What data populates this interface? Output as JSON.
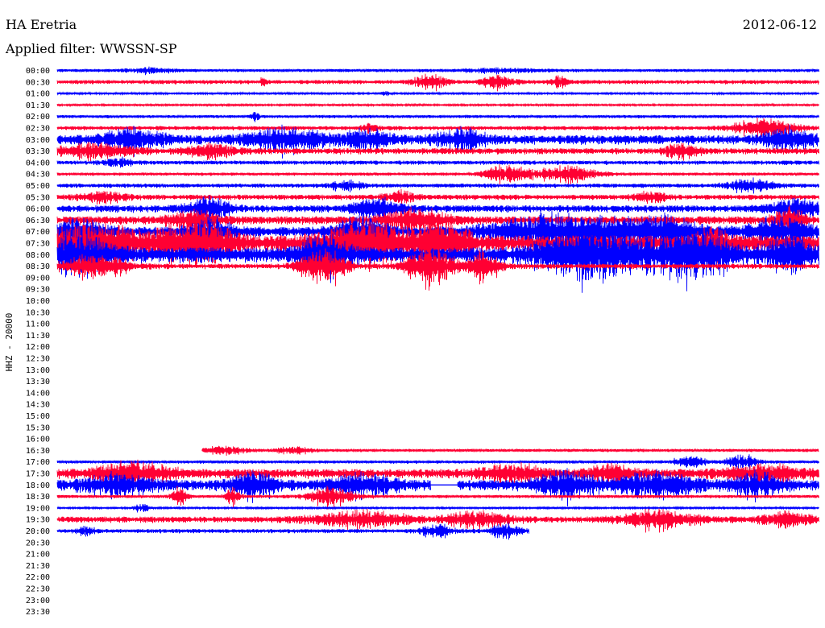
{
  "header": {
    "station": "HA Eretria",
    "date": "2012-06-12",
    "filter": "Applied filter: WWSSN-SP"
  },
  "chart_data": {
    "type": "line",
    "title": "HA Eretria",
    "channel_label": "HHZ - 20000",
    "row_labels": [
      "00:00",
      "00:30",
      "01:00",
      "01:30",
      "02:00",
      "02:30",
      "03:00",
      "03:30",
      "04:00",
      "04:30",
      "05:00",
      "05:30",
      "06:00",
      "06:30",
      "07:00",
      "07:30",
      "08:00",
      "08:30",
      "09:00",
      "09:30",
      "10:00",
      "10:30",
      "11:00",
      "11:30",
      "12:00",
      "12:30",
      "13:00",
      "13:30",
      "14:00",
      "14:30",
      "15:00",
      "15:30",
      "16:00",
      "16:30",
      "17:00",
      "17:30",
      "18:00",
      "18:30",
      "19:00",
      "19:30",
      "20:00",
      "20:30",
      "21:00",
      "21:30",
      "22:00",
      "22:30",
      "23:00",
      "23:30"
    ],
    "colors": {
      "even": "#0000ff",
      "odd": "#ff0033"
    },
    "traces": [
      {
        "row": 0,
        "start": 0,
        "end": 1,
        "level": 0.3,
        "bursts": [
          [
            0.12,
            0.03,
            0.4
          ],
          [
            0.58,
            0.05,
            0.3
          ]
        ]
      },
      {
        "row": 1,
        "start": 0,
        "end": 1,
        "level": 0.4,
        "bursts": [
          [
            0.49,
            0.02,
            1.4
          ],
          [
            0.58,
            0.02,
            1.2
          ],
          [
            0.66,
            0.01,
            1.0
          ],
          [
            0.27,
            0.005,
            0.7
          ]
        ]
      },
      {
        "row": 2,
        "start": 0,
        "end": 1,
        "level": 0.2,
        "bursts": [
          [
            0.43,
            0.005,
            0.6
          ]
        ]
      },
      {
        "row": 3,
        "start": 0,
        "end": 1,
        "level": 0.2,
        "bursts": []
      },
      {
        "row": 4,
        "start": 0,
        "end": 1,
        "level": 0.3,
        "bursts": [
          [
            0.26,
            0.005,
            0.8
          ]
        ]
      },
      {
        "row": 5,
        "start": 0,
        "end": 1,
        "level": 0.4,
        "bursts": [
          [
            0.93,
            0.04,
            1.6
          ],
          [
            0.41,
            0.01,
            0.7
          ]
        ]
      },
      {
        "row": 6,
        "start": 0,
        "end": 1,
        "level": 0.9,
        "bursts": [
          [
            0.1,
            0.04,
            1.6
          ],
          [
            0.3,
            0.05,
            1.8
          ],
          [
            0.41,
            0.03,
            1.5
          ],
          [
            0.53,
            0.03,
            1.7
          ],
          [
            0.96,
            0.03,
            1.6
          ]
        ]
      },
      {
        "row": 7,
        "start": 0,
        "end": 1,
        "level": 0.6,
        "bursts": [
          [
            0.05,
            0.05,
            1.2
          ],
          [
            0.2,
            0.03,
            1.1
          ],
          [
            0.82,
            0.02,
            1.2
          ]
        ]
      },
      {
        "row": 8,
        "start": 0,
        "end": 1,
        "level": 0.4,
        "bursts": [
          [
            0.08,
            0.02,
            0.7
          ]
        ]
      },
      {
        "row": 9,
        "start": 0,
        "end": 1,
        "level": 0.3,
        "bursts": [
          [
            0.59,
            0.03,
            1.5
          ],
          [
            0.67,
            0.04,
            1.3
          ]
        ]
      },
      {
        "row": 10,
        "start": 0,
        "end": 1,
        "level": 0.4,
        "bursts": [
          [
            0.38,
            0.02,
            0.8
          ],
          [
            0.91,
            0.03,
            1.0
          ]
        ]
      },
      {
        "row": 11,
        "start": 0,
        "end": 1,
        "level": 0.5,
        "bursts": [
          [
            0.06,
            0.03,
            0.9
          ],
          [
            0.45,
            0.02,
            1.0
          ],
          [
            0.78,
            0.02,
            1.0
          ]
        ]
      },
      {
        "row": 12,
        "start": 0,
        "end": 1,
        "level": 0.7,
        "bursts": [
          [
            0.2,
            0.03,
            1.6
          ],
          [
            0.42,
            0.03,
            1.7
          ],
          [
            0.97,
            0.03,
            1.7
          ]
        ]
      },
      {
        "row": 13,
        "start": 0,
        "end": 1,
        "level": 0.8,
        "bursts": [
          [
            0.18,
            0.03,
            1.5
          ],
          [
            0.47,
            0.04,
            1.7
          ],
          [
            0.96,
            0.02,
            2.0
          ]
        ]
      },
      {
        "row": 14,
        "start": 0,
        "end": 1,
        "level": 1.0,
        "bursts": [
          [
            0.03,
            0.03,
            2.0
          ],
          [
            0.2,
            0.03,
            2.0
          ],
          [
            0.4,
            0.03,
            2.5
          ],
          [
            0.65,
            0.08,
            2.6
          ],
          [
            0.78,
            0.06,
            2.6
          ],
          [
            0.95,
            0.04,
            2.2
          ]
        ]
      },
      {
        "row": 15,
        "start": 0,
        "end": 1,
        "level": 1.6,
        "bursts": [
          [
            0.05,
            0.05,
            3.0
          ],
          [
            0.18,
            0.05,
            3.2
          ],
          [
            0.4,
            0.05,
            3.2
          ],
          [
            0.5,
            0.04,
            3.0
          ],
          [
            0.86,
            0.02,
            2.2
          ]
        ]
      },
      {
        "row": 16,
        "start": 0,
        "end": 1,
        "level": 1.5,
        "bursts": [
          [
            0.03,
            0.04,
            3.0
          ],
          [
            0.35,
            0.03,
            3.0
          ],
          [
            0.7,
            0.06,
            4.2
          ],
          [
            0.83,
            0.05,
            3.8
          ],
          [
            0.96,
            0.03,
            3.0
          ]
        ]
      },
      {
        "row": 17,
        "start": 0,
        "end": 1,
        "level": 0.5,
        "bursts": [
          [
            0.05,
            0.04,
            2.0
          ],
          [
            0.35,
            0.03,
            2.8
          ],
          [
            0.49,
            0.03,
            3.5
          ],
          [
            0.56,
            0.02,
            2.4
          ]
        ]
      },
      {
        "row": 33,
        "start": 0.19,
        "end": 1,
        "level": 0.3,
        "bursts": [
          [
            0.22,
            0.03,
            0.7
          ],
          [
            0.31,
            0.02,
            0.6
          ]
        ]
      },
      {
        "row": 34,
        "start": 0,
        "end": 1,
        "level": 0.3,
        "bursts": [
          [
            0.83,
            0.02,
            1.0
          ],
          [
            0.9,
            0.02,
            1.2
          ]
        ]
      },
      {
        "row": 35,
        "start": 0,
        "end": 1,
        "level": 0.9,
        "bursts": [
          [
            0.1,
            0.05,
            1.6
          ],
          [
            0.6,
            0.04,
            1.3
          ],
          [
            0.73,
            0.03,
            1.2
          ],
          [
            0.93,
            0.05,
            1.2
          ]
        ]
      },
      {
        "row": 36,
        "start": 0,
        "end": 1,
        "level": 1.0,
        "bursts": [
          [
            0.08,
            0.04,
            1.5
          ],
          [
            0.26,
            0.03,
            1.8
          ],
          [
            0.4,
            0.04,
            1.6
          ],
          [
            0.67,
            0.04,
            2.0
          ],
          [
            0.79,
            0.05,
            1.8
          ],
          [
            0.92,
            0.03,
            1.7
          ]
        ],
        "gaps": [
          [
            0.49,
            0.525
          ]
        ]
      },
      {
        "row": 37,
        "start": 0,
        "end": 1,
        "level": 0.3,
        "bursts": [
          [
            0.16,
            0.01,
            1.6
          ],
          [
            0.23,
            0.01,
            1.5
          ],
          [
            0.36,
            0.03,
            1.6
          ]
        ]
      },
      {
        "row": 38,
        "start": 0,
        "end": 1,
        "level": 0.2,
        "bursts": [
          [
            0.11,
            0.01,
            0.6
          ]
        ]
      },
      {
        "row": 39,
        "start": 0,
        "end": 1,
        "level": 0.6,
        "bursts": [
          [
            0.4,
            0.06,
            1.3
          ],
          [
            0.55,
            0.04,
            1.3
          ],
          [
            0.79,
            0.05,
            1.4
          ],
          [
            0.96,
            0.03,
            1.3
          ]
        ]
      },
      {
        "row": 40,
        "start": 0,
        "end": 0.62,
        "level": 0.4,
        "bursts": [
          [
            0.04,
            0.01,
            0.9
          ],
          [
            0.5,
            0.02,
            1.0
          ],
          [
            0.59,
            0.02,
            1.2
          ]
        ]
      }
    ]
  }
}
